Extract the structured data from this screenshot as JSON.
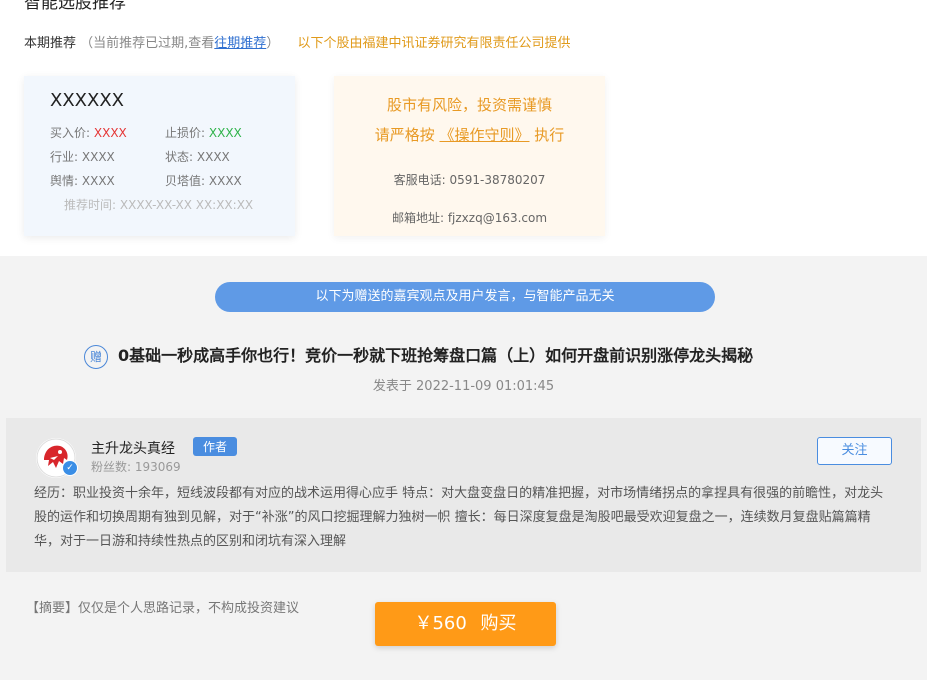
{
  "header": {
    "cut_title": "智能选股推荐",
    "cut_right": ""
  },
  "recommend": {
    "label": "本期推荐",
    "note_pre": "（当前推荐已过期,查看",
    "link": "往期推荐",
    "note_post": "）",
    "provider": "以下个股由福建中讯证券研究有限责任公司提供"
  },
  "stock_card": {
    "name": "XXXXXX",
    "buy_label": "买入价:",
    "buy_value": "XXXX",
    "stop_label": "止损价:",
    "stop_value": "XXXX",
    "industry_label": "行业:",
    "industry_value": "XXXX",
    "status_label": "状态:",
    "status_value": "XXXX",
    "sentiment_label": "舆情:",
    "sentiment_value": "XXXX",
    "beta_label": "贝塔值:",
    "beta_value": "XXXX",
    "time_label": "推荐时间:",
    "time_value": "XXXX-XX-XX XX:XX:XX"
  },
  "risk_card": {
    "line1": "股市有风险，投资需谨慎",
    "line2_pre": "请严格按",
    "line2_link": "《操作守则》",
    "line2_post": "执行",
    "phone_label": "客服电话:",
    "phone": "0591-38780207",
    "email_label": "邮箱地址:",
    "email": "fjzxzq@163.com"
  },
  "banner": "以下为赠送的嘉宾观点及用户发言，与智能产品无关",
  "article": {
    "gift_icon_text": "赠",
    "title": "0基础一秒成高手你也行！竞价一秒就下班抢筹盘口篇（上）如何开盘前识别涨停龙头揭秘",
    "posted_label": "发表于",
    "posted_time": "2022-11-09 01:01:45"
  },
  "author": {
    "name": "主升龙头真经",
    "badge": "作者",
    "fans_label": "粉丝数:",
    "fans": "193069",
    "follow": "关注",
    "bio": "经历：职业投资十余年，短线波段都有对应的战术运用得心应手 特点：对大盘变盘日的精准把握，对市场情绪拐点的拿捏具有很强的前瞻性，对龙头股的运作和切换周期有独到见解，对于“补涨”的风口挖掘理解力独树一帜 擅长：每日深度复盘是淘股吧最受欢迎复盘之一，连续数月复盘贴篇篇精华，对于一日游和持续性热点的区别和闭坑有深入理解"
  },
  "summary": {
    "label": "【摘要】",
    "text": "仅仅是个人思路记录，不构成投资建议"
  },
  "buy": {
    "price": "￥560",
    "label": "购买"
  },
  "colors": {
    "accent_blue": "#4a8de0",
    "orange": "#ff9a17",
    "red": "#e53535",
    "green": "#2fb34a"
  }
}
